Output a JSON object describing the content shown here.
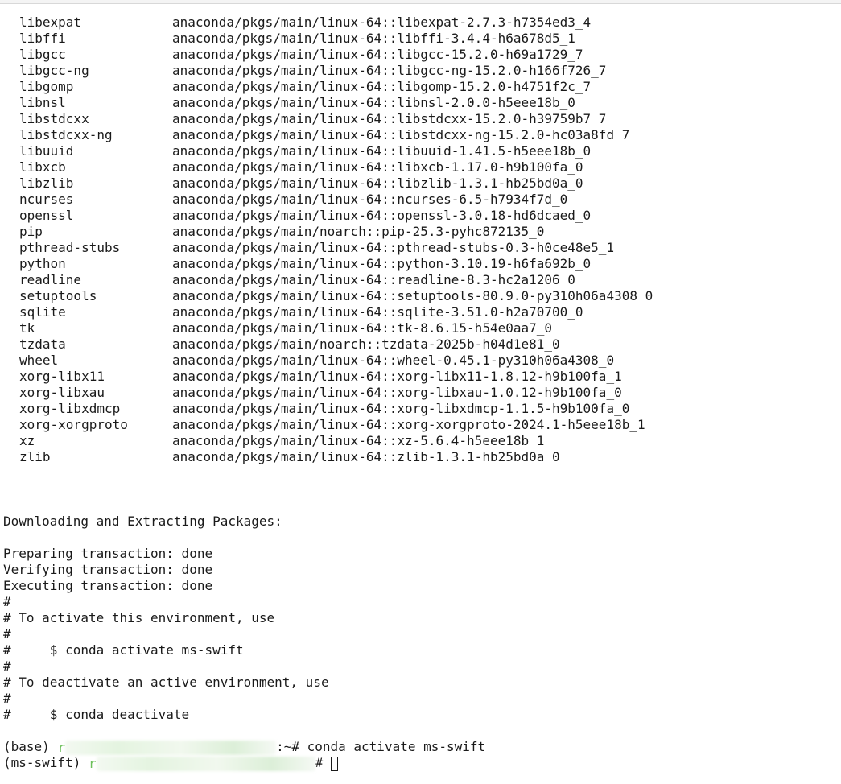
{
  "packages": [
    {
      "name": "libexpat",
      "spec": "anaconda/pkgs/main/linux-64::libexpat-2.7.3-h7354ed3_4"
    },
    {
      "name": "libffi",
      "spec": "anaconda/pkgs/main/linux-64::libffi-3.4.4-h6a678d5_1"
    },
    {
      "name": "libgcc",
      "spec": "anaconda/pkgs/main/linux-64::libgcc-15.2.0-h69a1729_7"
    },
    {
      "name": "libgcc-ng",
      "spec": "anaconda/pkgs/main/linux-64::libgcc-ng-15.2.0-h166f726_7"
    },
    {
      "name": "libgomp",
      "spec": "anaconda/pkgs/main/linux-64::libgomp-15.2.0-h4751f2c_7"
    },
    {
      "name": "libnsl",
      "spec": "anaconda/pkgs/main/linux-64::libnsl-2.0.0-h5eee18b_0"
    },
    {
      "name": "libstdcxx",
      "spec": "anaconda/pkgs/main/linux-64::libstdcxx-15.2.0-h39759b7_7"
    },
    {
      "name": "libstdcxx-ng",
      "spec": "anaconda/pkgs/main/linux-64::libstdcxx-ng-15.2.0-hc03a8fd_7"
    },
    {
      "name": "libuuid",
      "spec": "anaconda/pkgs/main/linux-64::libuuid-1.41.5-h5eee18b_0"
    },
    {
      "name": "libxcb",
      "spec": "anaconda/pkgs/main/linux-64::libxcb-1.17.0-h9b100fa_0"
    },
    {
      "name": "libzlib",
      "spec": "anaconda/pkgs/main/linux-64::libzlib-1.3.1-hb25bd0a_0"
    },
    {
      "name": "ncurses",
      "spec": "anaconda/pkgs/main/linux-64::ncurses-6.5-h7934f7d_0"
    },
    {
      "name": "openssl",
      "spec": "anaconda/pkgs/main/linux-64::openssl-3.0.18-hd6dcaed_0"
    },
    {
      "name": "pip",
      "spec": "anaconda/pkgs/main/noarch::pip-25.3-pyhc872135_0"
    },
    {
      "name": "pthread-stubs",
      "spec": "anaconda/pkgs/main/linux-64::pthread-stubs-0.3-h0ce48e5_1"
    },
    {
      "name": "python",
      "spec": "anaconda/pkgs/main/linux-64::python-3.10.19-h6fa692b_0"
    },
    {
      "name": "readline",
      "spec": "anaconda/pkgs/main/linux-64::readline-8.3-hc2a1206_0"
    },
    {
      "name": "setuptools",
      "spec": "anaconda/pkgs/main/linux-64::setuptools-80.9.0-py310h06a4308_0"
    },
    {
      "name": "sqlite",
      "spec": "anaconda/pkgs/main/linux-64::sqlite-3.51.0-h2a70700_0"
    },
    {
      "name": "tk",
      "spec": "anaconda/pkgs/main/linux-64::tk-8.6.15-h54e0aa7_0"
    },
    {
      "name": "tzdata",
      "spec": "anaconda/pkgs/main/noarch::tzdata-2025b-h04d1e81_0"
    },
    {
      "name": "wheel",
      "spec": "anaconda/pkgs/main/linux-64::wheel-0.45.1-py310h06a4308_0"
    },
    {
      "name": "xorg-libx11",
      "spec": "anaconda/pkgs/main/linux-64::xorg-libx11-1.8.12-h9b100fa_1"
    },
    {
      "name": "xorg-libxau",
      "spec": "anaconda/pkgs/main/linux-64::xorg-libxau-1.0.12-h9b100fa_0"
    },
    {
      "name": "xorg-libxdmcp",
      "spec": "anaconda/pkgs/main/linux-64::xorg-libxdmcp-1.1.5-h9b100fa_0"
    },
    {
      "name": "xorg-xorgproto",
      "spec": "anaconda/pkgs/main/linux-64::xorg-xorgproto-2024.1-h5eee18b_1"
    },
    {
      "name": "xz",
      "spec": "anaconda/pkgs/main/linux-64::xz-5.6.4-h5eee18b_1"
    },
    {
      "name": "zlib",
      "spec": "anaconda/pkgs/main/linux-64::zlib-1.3.1-hb25bd0a_0"
    }
  ],
  "download_header": "Downloading and Extracting Packages:",
  "transaction": {
    "preparing": "Preparing transaction: done",
    "verifying": "Verifying transaction: done",
    "executing": "Executing transaction: done"
  },
  "comments": {
    "c1": "#",
    "c2": "# To activate this environment, use",
    "c3": "#",
    "c4": "#     $ conda activate ms-swift",
    "c5": "#",
    "c6": "# To deactivate an active environment, use",
    "c7": "#",
    "c8": "#     $ conda deactivate"
  },
  "prompts": {
    "p1_env": "(base) ",
    "p1_user_initial": "r",
    "p1_tail": ":~# ",
    "p1_command": "conda activate ms-swift",
    "p2_env": "(ms-swift) ",
    "p2_user_initial": "r",
    "p2_tail": "# "
  },
  "colors": {
    "text": "#1a1a1a",
    "redaction_green": "#6cc05a",
    "background": "#ffffff"
  }
}
